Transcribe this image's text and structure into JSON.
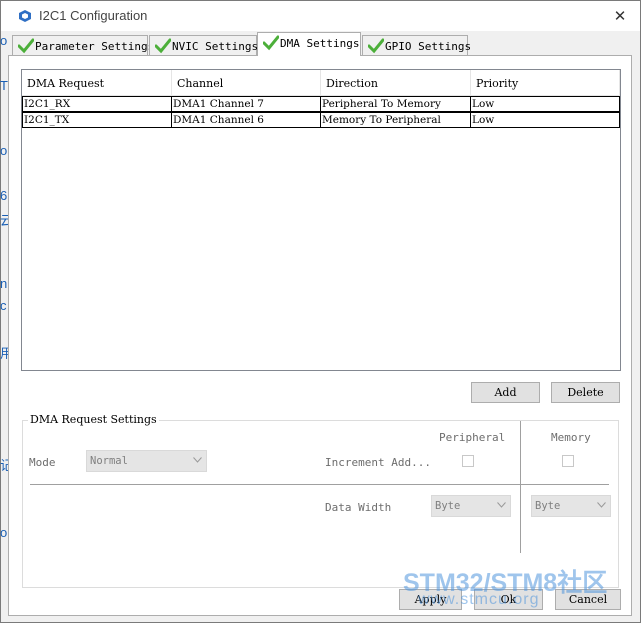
{
  "window": {
    "title": "I2C1 Configuration",
    "close_glyph": "✕"
  },
  "background_bleed": [
    "o",
    "T",
    "o",
    "6",
    "云",
    "n",
    "c",
    "用",
    "记",
    "o"
  ],
  "tabs": [
    {
      "label": "Parameter Settings",
      "active": false
    },
    {
      "label": "NVIC Settings",
      "active": false
    },
    {
      "label": "DMA Settings",
      "active": true
    },
    {
      "label": "GPIO Settings",
      "active": false
    }
  ],
  "table": {
    "headers": [
      "DMA Request",
      "Channel",
      "Direction",
      "Priority"
    ],
    "rows": [
      [
        "I2C1_RX",
        "DMA1 Channel 7",
        "Peripheral To Memory",
        "Low"
      ],
      [
        "I2C1_TX",
        "DMA1 Channel 6",
        "Memory To Peripheral",
        "Low"
      ]
    ]
  },
  "buttons": {
    "add": "Add",
    "delete": "Delete",
    "apply": "Apply",
    "ok": "Ok",
    "cancel": "Cancel"
  },
  "request_settings": {
    "title": "DMA Request Settings",
    "mode_label": "Mode",
    "mode_value": "Normal",
    "peripheral_header": "Peripheral",
    "memory_header": "Memory",
    "increment_label": "Increment Add...",
    "data_width_label": "Data Width",
    "peripheral_width": "Byte",
    "memory_width": "Byte"
  },
  "watermark": {
    "line1": "STM32/STM8社区",
    "line2": "www.stmcu.org"
  },
  "colors": {
    "check": "#4caf3a",
    "link_blue": "#1a5fb4"
  }
}
